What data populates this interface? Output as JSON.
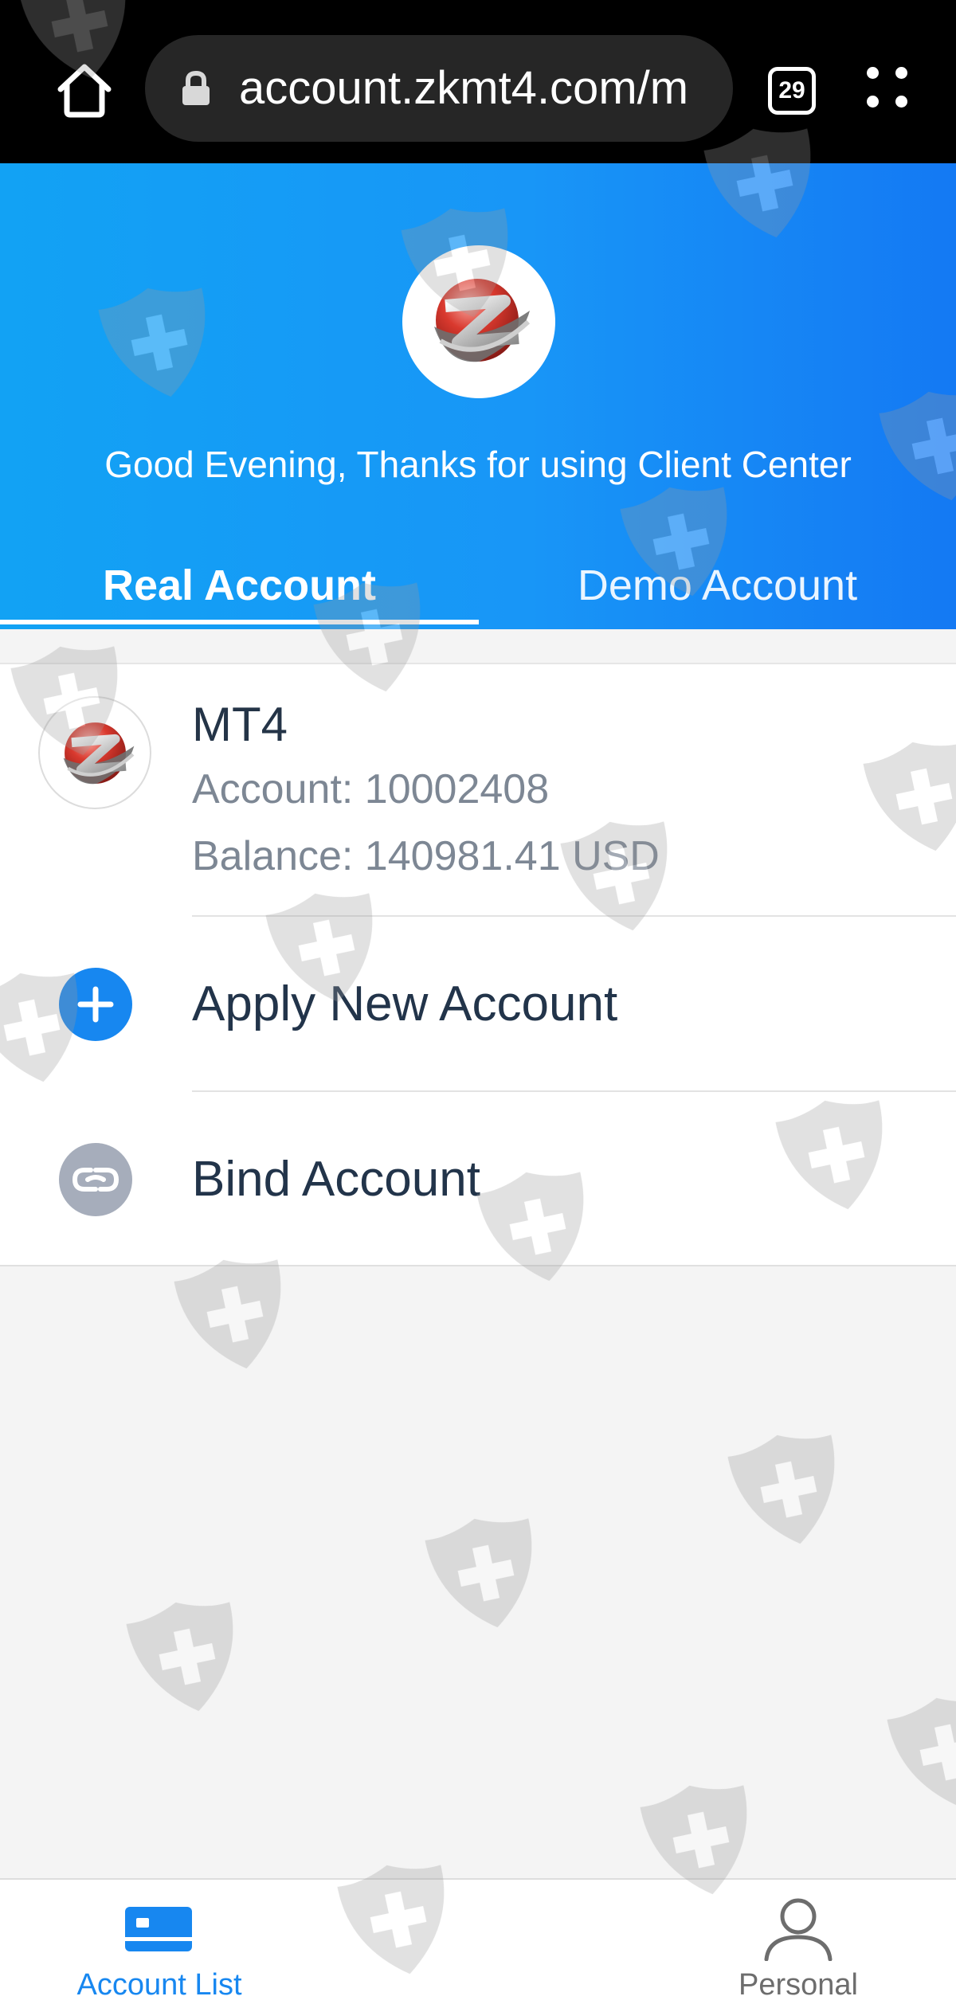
{
  "browser": {
    "url": "account.zkmt4.com/m",
    "tab_count": "29",
    "home_icon": "home-icon",
    "lock_icon": "lock-icon",
    "menu_icon": "more-vertical-icon"
  },
  "header": {
    "greeting": "Good Evening, Thanks for using Client Center",
    "tabs": [
      {
        "label": "Real Account",
        "selected": true
      },
      {
        "label": "Demo Account",
        "selected": false
      }
    ]
  },
  "account": {
    "platform": "MT4",
    "account_line": "Account: 10002408",
    "balance_line": "Balance: 140981.41 USD"
  },
  "actions": {
    "apply_label": "Apply New Account",
    "bind_label": "Bind Account"
  },
  "bottom_nav": {
    "items": [
      {
        "label": "Account List",
        "icon": "card-icon",
        "active": true
      },
      {
        "label": "Personal",
        "icon": "person-icon",
        "active": false
      }
    ]
  },
  "colors": {
    "header_blue": "#1896f7",
    "accent_blue": "#1787f0",
    "muted_text": "#7d8794",
    "background": "#f4f4f4"
  }
}
